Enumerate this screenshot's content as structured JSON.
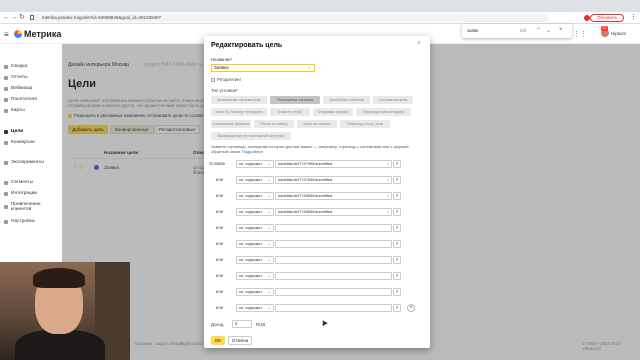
{
  "browser": {
    "url": "metrika.yandex.ru/goals?id=53068845&goal_id=291209407",
    "update_label": "Обновить",
    "find": {
      "query": "заявк",
      "count": "0/0"
    }
  },
  "app": {
    "brand": "Метрика",
    "user": "Hipkom",
    "notifications": "12"
  },
  "sidebar": {
    "items": [
      {
        "label": "Сводка",
        "icon": "summary-icon"
      },
      {
        "label": "Отчеты",
        "icon": "reports-icon"
      },
      {
        "label": "Вебвизор",
        "icon": "webvisor-icon"
      },
      {
        "label": "Посетители",
        "icon": "visitors-icon"
      },
      {
        "label": "Карты",
        "icon": "maps-icon"
      },
      {
        "label": "Цели",
        "icon": "goals-icon"
      },
      {
        "label": "Конверсии",
        "icon": "conversions-icon"
      },
      {
        "label": "Эксперименты",
        "icon": "experiments-icon"
      },
      {
        "label": "Сегменты",
        "icon": "segments-icon"
      },
      {
        "label": "Интеграции",
        "icon": "integrations-icon"
      },
      {
        "label": "Привлечение клиентов",
        "icon": "acquisition-icon"
      },
      {
        "label": "Настройка",
        "icon": "settings-icon"
      }
    ]
  },
  "page": {
    "breadcrumb": "Дизайн интерьера Москва",
    "breadcrumb_counter": "project7587-0060-00de.ru",
    "title": "Цели",
    "description": "Цели позволяют отслеживать важные события на сайте: клики на кнопки, отправку формы и многое другое. На одном счетчике может быть до...",
    "auto_goals_label": "Разрешить в рекламных компаниях отслеживать цели по ссылке",
    "add_goal_label": "Добавить цель",
    "tabs": [
      "Конверсионные",
      "Ретаргетинговые"
    ],
    "table_headers": [
      "Название цели",
      "Описание"
    ],
    "rows": [
      {
        "name": "Заявка",
        "side": "url содержит",
        "side2": "/thankyou"
      }
    ],
    "footer": [
      "Справка",
      "Задать вопрос",
      "Подписаться",
      "Блог",
      "API",
      "Данные",
      "Для разработчиков"
    ],
    "footer_right": "© 2008—2023 ООО «Яндекс»"
  },
  "modal": {
    "title": "Редактировать цель",
    "name_label": "Название",
    "name_value": "Заявка",
    "retarget_label": "Ретаргетинг",
    "type_label": "Тип условия",
    "chips": [
      {
        "label": "Количество просмотров",
        "selected": false
      },
      {
        "label": "Посещение страниц",
        "selected": true
      },
      {
        "label": "JavaScript-событие",
        "selected": false
      },
      {
        "label": "Составная цель",
        "selected": false
      },
      {
        "label": "Клик по номеру телефона",
        "selected": false
      },
      {
        "label": "Клик по email",
        "selected": false
      },
      {
        "label": "Отправка формы",
        "selected": false
      },
      {
        "label": "Переход в мессенджер",
        "selected": false
      },
      {
        "label": "Скачивание файлов",
        "selected": false
      },
      {
        "label": "Поиск по сайту",
        "selected": false
      },
      {
        "label": "Клик по кнопке",
        "selected": false
      },
      {
        "label": "Переход в соц. сеть",
        "selected": false
      },
      {
        "label": "Возвращение на платежной системы",
        "selected": false
      }
    ],
    "hint": "Укажите страницы, посещение которых для вас важно — например, страницу с контактами или с формой обратной связи.",
    "hint_link": "Подробнее",
    "conditions": [
      {
        "label": "Условие",
        "op": "url: содержит",
        "value": "#ddaftanxfvf7747995/submitted"
      },
      {
        "label": "или",
        "op": "url: содержит",
        "value": "#ddaftanxfvf7747840/submitted"
      },
      {
        "label": "или",
        "op": "url: содержит",
        "value": "#ddaftanxfvf7740840/submitted"
      },
      {
        "label": "или",
        "op": "url: содержит",
        "value": "#ddaftanxfvf7740840/submitted"
      },
      {
        "label": "или",
        "op": "url: содержит",
        "value": ""
      },
      {
        "label": "или",
        "op": "url: содержит",
        "value": ""
      },
      {
        "label": "или",
        "op": "url: содержит",
        "value": ""
      },
      {
        "label": "или",
        "op": "url: содержит",
        "value": ""
      },
      {
        "label": "или",
        "op": "url: содержит",
        "value": ""
      },
      {
        "label": "или",
        "op": "url: содержит",
        "value": ""
      }
    ],
    "income_label": "Доход",
    "income_value": "0",
    "income_currency": "RUB",
    "ok_label": "OK",
    "cancel_label": "Отмена"
  }
}
